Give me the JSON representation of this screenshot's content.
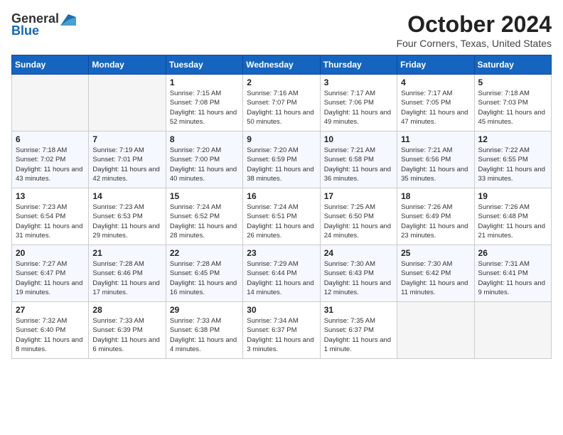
{
  "header": {
    "logo_line1": "General",
    "logo_line2": "Blue",
    "title": "October 2024",
    "subtitle": "Four Corners, Texas, United States"
  },
  "days_of_week": [
    "Sunday",
    "Monday",
    "Tuesday",
    "Wednesday",
    "Thursday",
    "Friday",
    "Saturday"
  ],
  "weeks": [
    [
      {
        "day": "",
        "empty": true
      },
      {
        "day": "",
        "empty": true
      },
      {
        "day": "1",
        "sunrise": "Sunrise: 7:15 AM",
        "sunset": "Sunset: 7:08 PM",
        "daylight": "Daylight: 11 hours and 52 minutes."
      },
      {
        "day": "2",
        "sunrise": "Sunrise: 7:16 AM",
        "sunset": "Sunset: 7:07 PM",
        "daylight": "Daylight: 11 hours and 50 minutes."
      },
      {
        "day": "3",
        "sunrise": "Sunrise: 7:17 AM",
        "sunset": "Sunset: 7:06 PM",
        "daylight": "Daylight: 11 hours and 49 minutes."
      },
      {
        "day": "4",
        "sunrise": "Sunrise: 7:17 AM",
        "sunset": "Sunset: 7:05 PM",
        "daylight": "Daylight: 11 hours and 47 minutes."
      },
      {
        "day": "5",
        "sunrise": "Sunrise: 7:18 AM",
        "sunset": "Sunset: 7:03 PM",
        "daylight": "Daylight: 11 hours and 45 minutes."
      }
    ],
    [
      {
        "day": "6",
        "sunrise": "Sunrise: 7:18 AM",
        "sunset": "Sunset: 7:02 PM",
        "daylight": "Daylight: 11 hours and 43 minutes."
      },
      {
        "day": "7",
        "sunrise": "Sunrise: 7:19 AM",
        "sunset": "Sunset: 7:01 PM",
        "daylight": "Daylight: 11 hours and 42 minutes."
      },
      {
        "day": "8",
        "sunrise": "Sunrise: 7:20 AM",
        "sunset": "Sunset: 7:00 PM",
        "daylight": "Daylight: 11 hours and 40 minutes."
      },
      {
        "day": "9",
        "sunrise": "Sunrise: 7:20 AM",
        "sunset": "Sunset: 6:59 PM",
        "daylight": "Daylight: 11 hours and 38 minutes."
      },
      {
        "day": "10",
        "sunrise": "Sunrise: 7:21 AM",
        "sunset": "Sunset: 6:58 PM",
        "daylight": "Daylight: 11 hours and 36 minutes."
      },
      {
        "day": "11",
        "sunrise": "Sunrise: 7:21 AM",
        "sunset": "Sunset: 6:56 PM",
        "daylight": "Daylight: 11 hours and 35 minutes."
      },
      {
        "day": "12",
        "sunrise": "Sunrise: 7:22 AM",
        "sunset": "Sunset: 6:55 PM",
        "daylight": "Daylight: 11 hours and 33 minutes."
      }
    ],
    [
      {
        "day": "13",
        "sunrise": "Sunrise: 7:23 AM",
        "sunset": "Sunset: 6:54 PM",
        "daylight": "Daylight: 11 hours and 31 minutes."
      },
      {
        "day": "14",
        "sunrise": "Sunrise: 7:23 AM",
        "sunset": "Sunset: 6:53 PM",
        "daylight": "Daylight: 11 hours and 29 minutes."
      },
      {
        "day": "15",
        "sunrise": "Sunrise: 7:24 AM",
        "sunset": "Sunset: 6:52 PM",
        "daylight": "Daylight: 11 hours and 28 minutes."
      },
      {
        "day": "16",
        "sunrise": "Sunrise: 7:24 AM",
        "sunset": "Sunset: 6:51 PM",
        "daylight": "Daylight: 11 hours and 26 minutes."
      },
      {
        "day": "17",
        "sunrise": "Sunrise: 7:25 AM",
        "sunset": "Sunset: 6:50 PM",
        "daylight": "Daylight: 11 hours and 24 minutes."
      },
      {
        "day": "18",
        "sunrise": "Sunrise: 7:26 AM",
        "sunset": "Sunset: 6:49 PM",
        "daylight": "Daylight: 11 hours and 23 minutes."
      },
      {
        "day": "19",
        "sunrise": "Sunrise: 7:26 AM",
        "sunset": "Sunset: 6:48 PM",
        "daylight": "Daylight: 11 hours and 21 minutes."
      }
    ],
    [
      {
        "day": "20",
        "sunrise": "Sunrise: 7:27 AM",
        "sunset": "Sunset: 6:47 PM",
        "daylight": "Daylight: 11 hours and 19 minutes."
      },
      {
        "day": "21",
        "sunrise": "Sunrise: 7:28 AM",
        "sunset": "Sunset: 6:46 PM",
        "daylight": "Daylight: 11 hours and 17 minutes."
      },
      {
        "day": "22",
        "sunrise": "Sunrise: 7:28 AM",
        "sunset": "Sunset: 6:45 PM",
        "daylight": "Daylight: 11 hours and 16 minutes."
      },
      {
        "day": "23",
        "sunrise": "Sunrise: 7:29 AM",
        "sunset": "Sunset: 6:44 PM",
        "daylight": "Daylight: 11 hours and 14 minutes."
      },
      {
        "day": "24",
        "sunrise": "Sunrise: 7:30 AM",
        "sunset": "Sunset: 6:43 PM",
        "daylight": "Daylight: 11 hours and 12 minutes."
      },
      {
        "day": "25",
        "sunrise": "Sunrise: 7:30 AM",
        "sunset": "Sunset: 6:42 PM",
        "daylight": "Daylight: 11 hours and 11 minutes."
      },
      {
        "day": "26",
        "sunrise": "Sunrise: 7:31 AM",
        "sunset": "Sunset: 6:41 PM",
        "daylight": "Daylight: 11 hours and 9 minutes."
      }
    ],
    [
      {
        "day": "27",
        "sunrise": "Sunrise: 7:32 AM",
        "sunset": "Sunset: 6:40 PM",
        "daylight": "Daylight: 11 hours and 8 minutes."
      },
      {
        "day": "28",
        "sunrise": "Sunrise: 7:33 AM",
        "sunset": "Sunset: 6:39 PM",
        "daylight": "Daylight: 11 hours and 6 minutes."
      },
      {
        "day": "29",
        "sunrise": "Sunrise: 7:33 AM",
        "sunset": "Sunset: 6:38 PM",
        "daylight": "Daylight: 11 hours and 4 minutes."
      },
      {
        "day": "30",
        "sunrise": "Sunrise: 7:34 AM",
        "sunset": "Sunset: 6:37 PM",
        "daylight": "Daylight: 11 hours and 3 minutes."
      },
      {
        "day": "31",
        "sunrise": "Sunrise: 7:35 AM",
        "sunset": "Sunset: 6:37 PM",
        "daylight": "Daylight: 11 hours and 1 minute."
      },
      {
        "day": "",
        "empty": true
      },
      {
        "day": "",
        "empty": true
      }
    ]
  ]
}
